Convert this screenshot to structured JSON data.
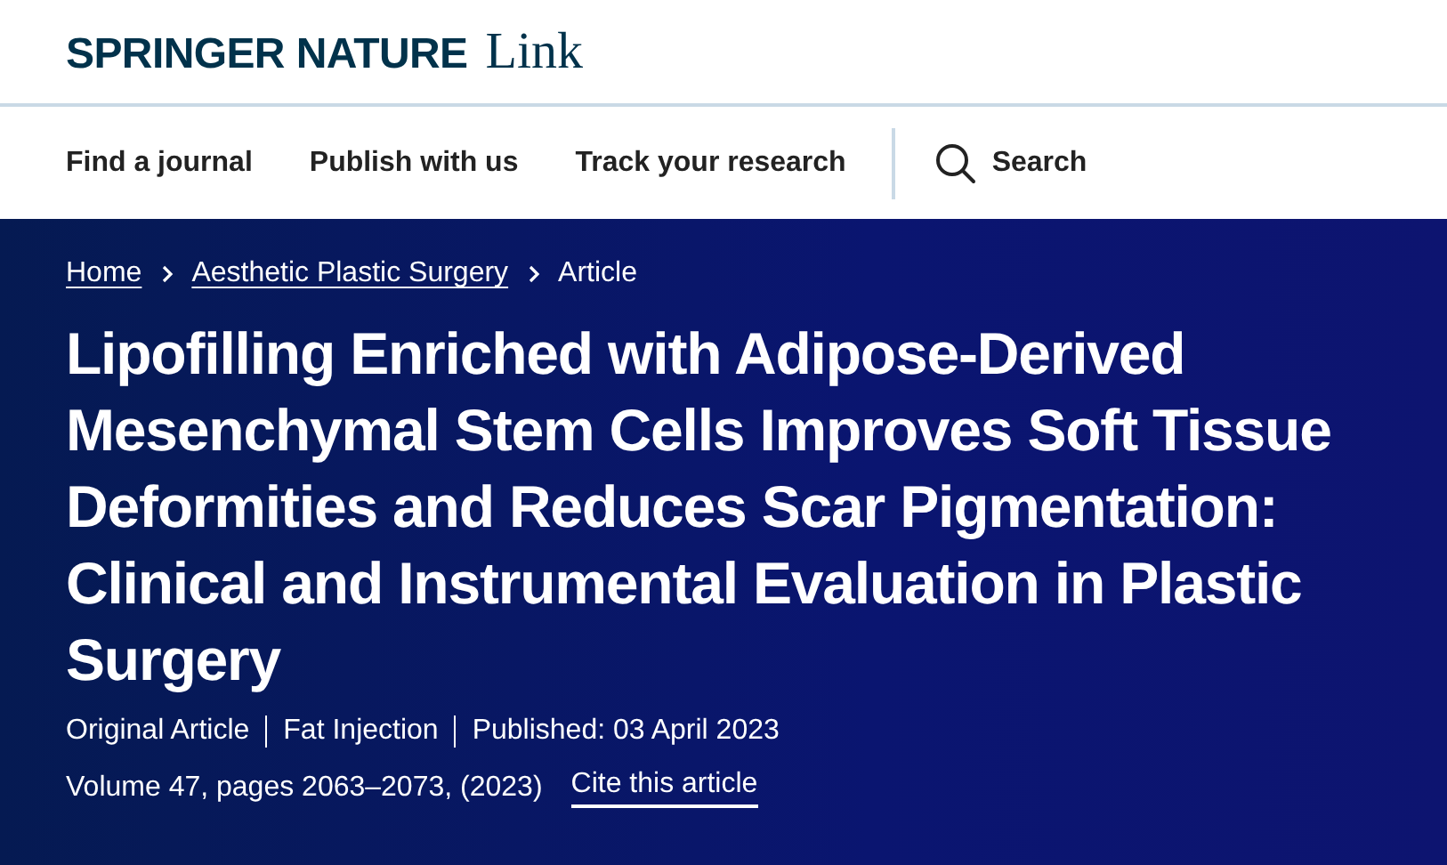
{
  "logo": {
    "brand": "SPRINGER NATURE",
    "product": "Link"
  },
  "nav": {
    "items": [
      "Find a journal",
      "Publish with us",
      "Track your research"
    ],
    "search": "Search"
  },
  "breadcrumb": [
    {
      "label": "Home",
      "link": true
    },
    {
      "label": "Aesthetic Plastic Surgery",
      "link": true
    },
    {
      "label": "Article",
      "link": false
    }
  ],
  "title": "Lipofilling Enriched with Adipose-Derived Mesenchymal Stem Cells Improves Soft Tissue Deformities and Reduces Scar Pigmentation: Clinical and Instrumental Evaluation in Plastic Surgery",
  "meta": [
    "Original Article",
    "Fat Injection",
    "Published: 03 April 2023"
  ],
  "citation": {
    "text": "Volume 47, pages 2063–2073, (2023)",
    "link": "Cite this article"
  }
}
